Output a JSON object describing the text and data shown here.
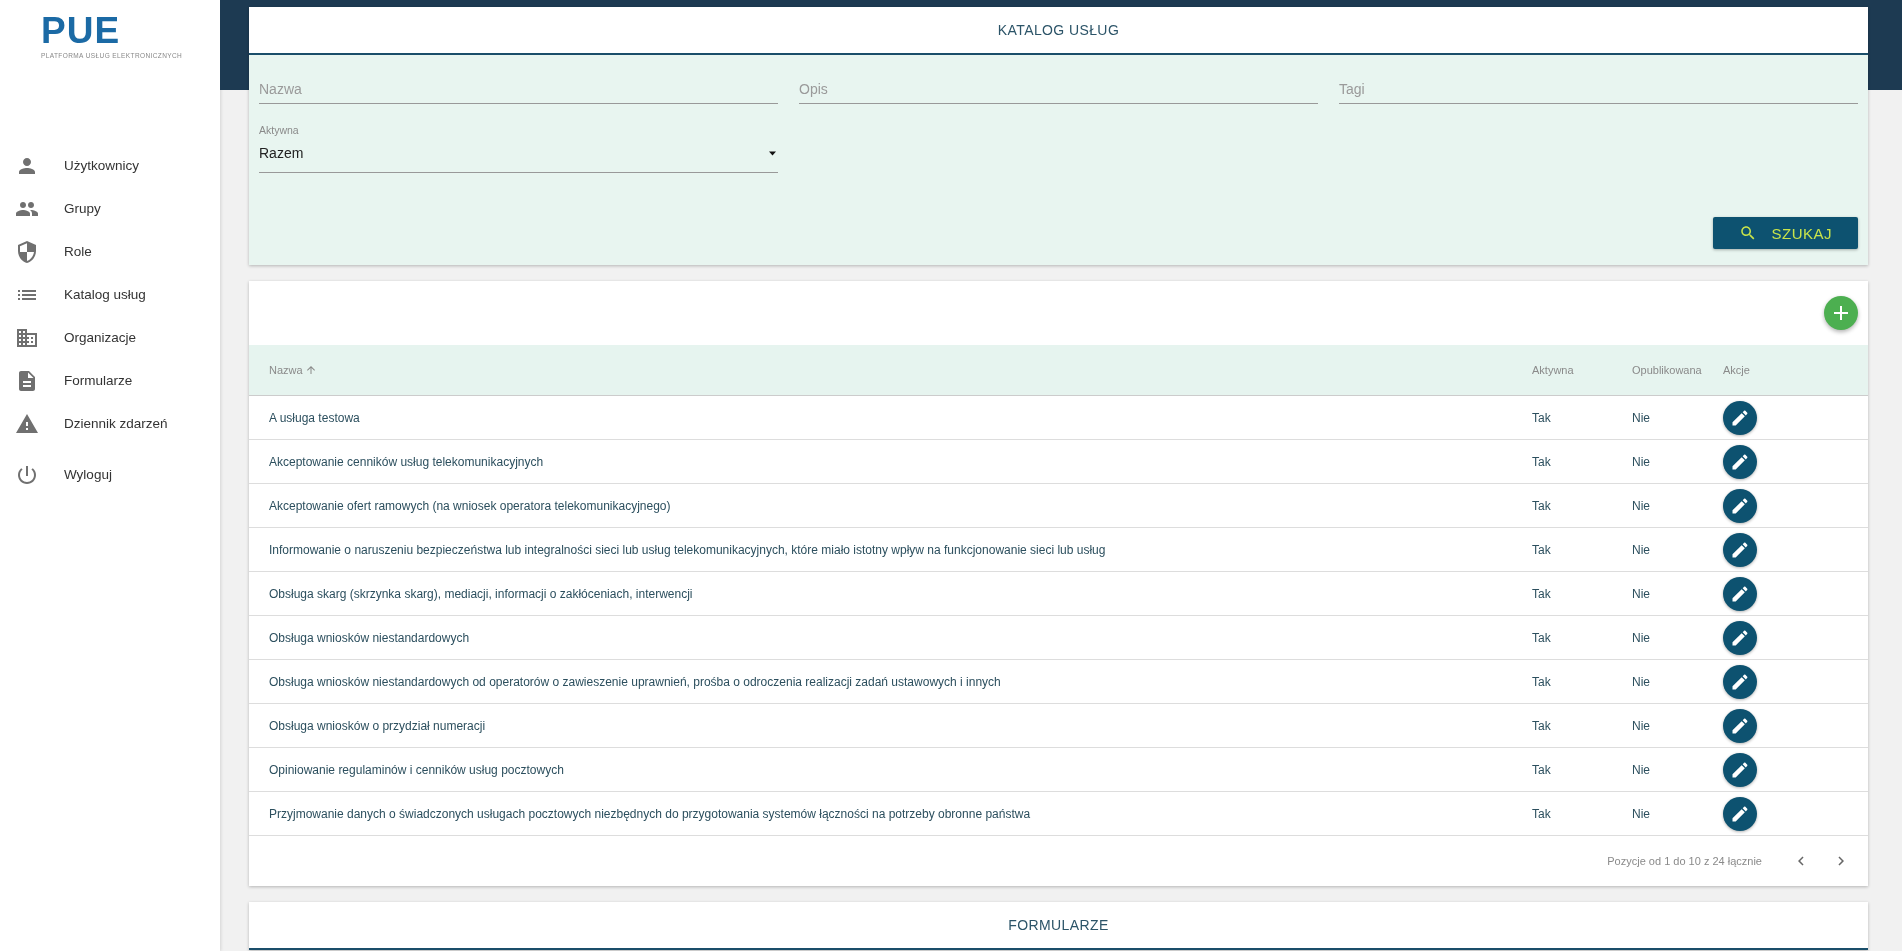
{
  "sidebar": {
    "logo": {
      "title": "PUE",
      "subtitle": "PLATFORMA USŁUG ELEKTRONICZNYCH"
    },
    "items": [
      {
        "label": "Użytkownicy",
        "kind": "person"
      },
      {
        "label": "Grupy",
        "kind": "group"
      },
      {
        "label": "Role",
        "kind": "shield"
      },
      {
        "label": "Katalog usług",
        "kind": "list"
      },
      {
        "label": "Organizacje",
        "kind": "building"
      },
      {
        "label": "Formularze",
        "kind": "document"
      },
      {
        "label": "Dziennik zdarzeń",
        "kind": "warning"
      },
      {
        "label": "Wyloguj",
        "kind": "power"
      }
    ]
  },
  "search_panel": {
    "title": "KATALOG USŁUG",
    "fields": [
      {
        "placeholder": "Nazwa"
      },
      {
        "placeholder": "Opis"
      },
      {
        "placeholder": "Tagi"
      }
    ],
    "select": {
      "label": "Aktywna",
      "value": "Razem"
    },
    "button": "SZUKAJ"
  },
  "table": {
    "columns": [
      {
        "label": "Nazwa",
        "sorted": true
      },
      {
        "label": "Aktywna",
        "sorted": false
      },
      {
        "label": "Opublikowana",
        "sorted": false
      },
      {
        "label": "Akcje",
        "sorted": false
      }
    ],
    "rows": [
      {
        "name": "A usługa testowa",
        "active": "Tak",
        "published": "Nie"
      },
      {
        "name": "Akceptowanie cenników usług telekomunikacyjnych",
        "active": "Tak",
        "published": "Nie"
      },
      {
        "name": "Akceptowanie ofert ramowych (na wniosek operatora telekomunikacyjnego)",
        "active": "Tak",
        "published": "Nie"
      },
      {
        "name": "Informowanie o naruszeniu bezpieczeństwa lub integralności sieci lub usług telekomunikacyjnych, które miało istotny wpływ na funkcjonowanie sieci lub usług",
        "active": "Tak",
        "published": "Nie"
      },
      {
        "name": "Obsługa skarg (skrzynka skarg), mediacji, informacji o zakłóceniach, interwencji",
        "active": "Tak",
        "published": "Nie"
      },
      {
        "name": "Obsługa wniosków niestandardowych",
        "active": "Tak",
        "published": "Nie"
      },
      {
        "name": "Obsługa wniosków niestandardowych od operatorów o zawieszenie uprawnień, prośba o odroczenia realizacji zadań ustawowych i innych",
        "active": "Tak",
        "published": "Nie"
      },
      {
        "name": "Obsługa wniosków o przydział numeracji",
        "active": "Tak",
        "published": "Nie"
      },
      {
        "name": "Opiniowanie regulaminów i cenników usług pocztowych",
        "active": "Tak",
        "published": "Nie"
      },
      {
        "name": "Przyjmowanie danych o świadczonych usługach pocztowych niezbędnych do przygotowania systemów łączności na potrzeby obronne państwa",
        "active": "Tak",
        "published": "Nie"
      }
    ],
    "pagination": "Pozycje od 1 do 10 z 24 łącznie"
  },
  "forms_panel": {
    "title": "FORMULARZE"
  }
}
